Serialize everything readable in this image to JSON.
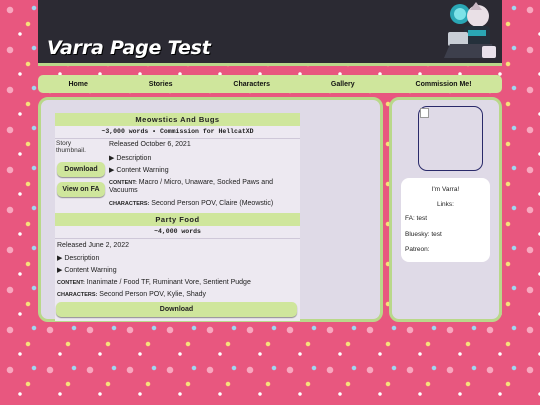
{
  "header": {
    "title": "Varra Page Test"
  },
  "nav": {
    "items": [
      "Home",
      "Stories",
      "Characters",
      "Gallery",
      "Commission Me!"
    ]
  },
  "stories": [
    {
      "title": "Meowstics And Bugs",
      "subtitle": "~3,000 words • Commission for HellcatXD",
      "thumb_alt": "Story thumbnail.",
      "released": "Released October 6, 2021",
      "description_label": "▶ Description",
      "warning_label": "▶ Content Warning",
      "content_label": "CONTENT:",
      "content_text": "Macro / Micro, Unaware, Socked Paws and Vacuums",
      "characters_label": "CHARACTERS:",
      "characters_text": "Second Person POV, Claire (Meowstic)",
      "download_label": "Download",
      "view_label": "View on FA"
    },
    {
      "title": "Party Food",
      "subtitle": "~4,000 words",
      "released": "Released June 2, 2022",
      "description_label": "▶ Description",
      "warning_label": "▶ Content Warning",
      "content_label": "CONTENT:",
      "content_text": "Inanimate / Food TF, Ruminant Vore, Sentient Pudge",
      "characters_label": "CHARACTERS:",
      "characters_text": "Second Person POV, Kylie, Shady",
      "download_label": "Download"
    }
  ],
  "sidebar": {
    "intro": "I'm Varra!",
    "links_heading": "Links:",
    "fa": "FA: test",
    "bluesky": "Bluesky: test",
    "patreon": "Patreon:"
  },
  "colors": {
    "accent_green": "#cfe69c",
    "header_dark": "#2b2a33",
    "panel_lavender": "#dfdae7",
    "background_pink": "#e8577f"
  }
}
